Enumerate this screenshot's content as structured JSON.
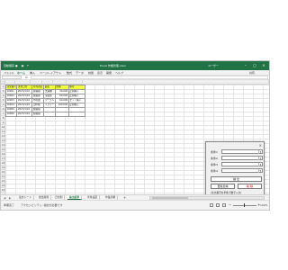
{
  "titlebar": {
    "autosave": "自動保存 ●",
    "doc_title": "Excel 作業管理.xlsm",
    "user": "ユーザー",
    "bg": "#217346"
  },
  "ribbon": {
    "tabs": [
      "ファイル",
      "ホーム",
      "挿入",
      "ページレイアウト",
      "数式",
      "データ",
      "校閲",
      "表示",
      "開発",
      "ヘルプ"
    ],
    "share": "共有"
  },
  "formula_bar": {
    "fx": "fx",
    "name_box": ""
  },
  "sheet": {
    "headers": [
      "注文番号",
      "注文日付",
      "担当者名",
      "品名",
      "金額",
      "備考"
    ],
    "rows": [
      [
        "10001",
        "2023/1/10",
        "佐藤樹",
        "洗濯機",
        "30,000",
        "定期購入"
      ],
      [
        "10002",
        "2023/1/10",
        "佐藤樹",
        "冷蔵庫",
        "80,000",
        "定期購入"
      ],
      [
        "10003",
        "2023/1/10",
        "中村雅",
        "テーブル",
        "60,000",
        "セット購入"
      ],
      [
        "10004",
        "2023/1/10",
        "田中聡",
        "ソファー",
        "100,000",
        "定期購入"
      ],
      [
        "10005",
        "2023/1/10",
        "佐藤樹",
        "",
        "",
        ""
      ],
      [
        "10006",
        "2023/1/10",
        "佐藤樹",
        "",
        "",
        ""
      ]
    ],
    "row_numbers": [
      "1",
      "2",
      "3",
      "4",
      "5",
      "6",
      "7",
      "8",
      "9",
      "10",
      "11",
      "12",
      "13",
      "14",
      "15",
      "16",
      "17",
      "18",
      "19",
      "20",
      "21",
      "22",
      "23",
      "24"
    ],
    "header_fill": "#f2ff3a"
  },
  "dialog": {
    "close": "×",
    "fields": [
      {
        "label": "条件1",
        "value": ""
      },
      {
        "label": "条件2",
        "value": ""
      },
      {
        "label": "条件3",
        "value": ""
      },
      {
        "label": "条件4",
        "value": ""
      }
    ],
    "main_button": "抽 出",
    "update_button": "更新反映",
    "delete_button": "削 除",
    "note": "(注文番号を半角で数字入力)"
  },
  "sheet_tabs": {
    "tabs": [
      "注文シート",
      "担当者別",
      "日付別",
      "抽出結果",
      "条件設定",
      "作業手順"
    ],
    "active_index": 3,
    "add": "+"
  },
  "statusbar": {
    "ready": "準備完了",
    "accessibility": "アクセシビリティ: 検討が必要です",
    "zoom": "100%"
  }
}
